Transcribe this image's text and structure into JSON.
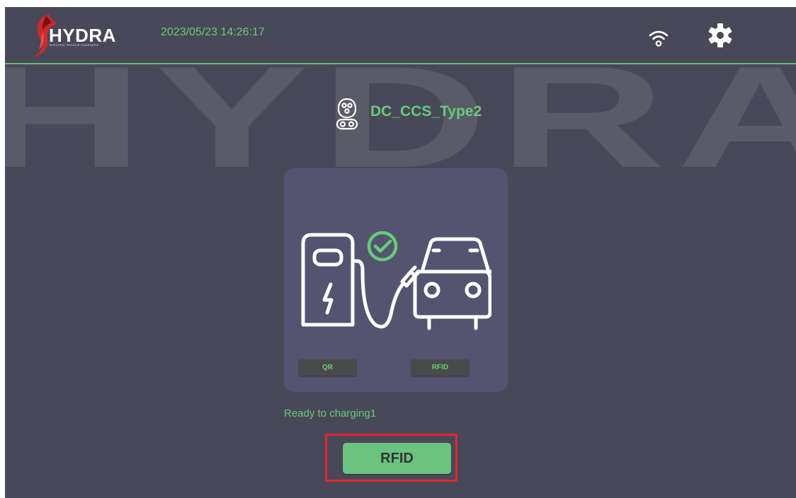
{
  "watermark": {
    "text": "HYDRA"
  },
  "header": {
    "brand": "HYDRA",
    "brand_subtitle": "ELECTRIC VEHICLE CHARGERS",
    "datetime": "2023/05/23 14:26:17",
    "icons": [
      "wifi-icon",
      "gear-icon"
    ]
  },
  "connector": {
    "label": "DC_CCS_Type2",
    "icon": "ccs-connector-icon"
  },
  "card": {
    "illustration": "ev-charger-car-check-icon",
    "buttons": [
      {
        "label": "QR"
      },
      {
        "label": "RFID"
      }
    ]
  },
  "status": {
    "text": "Ready to charging1"
  },
  "action": {
    "label": "RFID"
  },
  "colors": {
    "background": "#494858",
    "card": "#555470",
    "accent_green": "#66cc7a",
    "button_green": "#6bc47e",
    "highlight_red": "#e0282c"
  }
}
